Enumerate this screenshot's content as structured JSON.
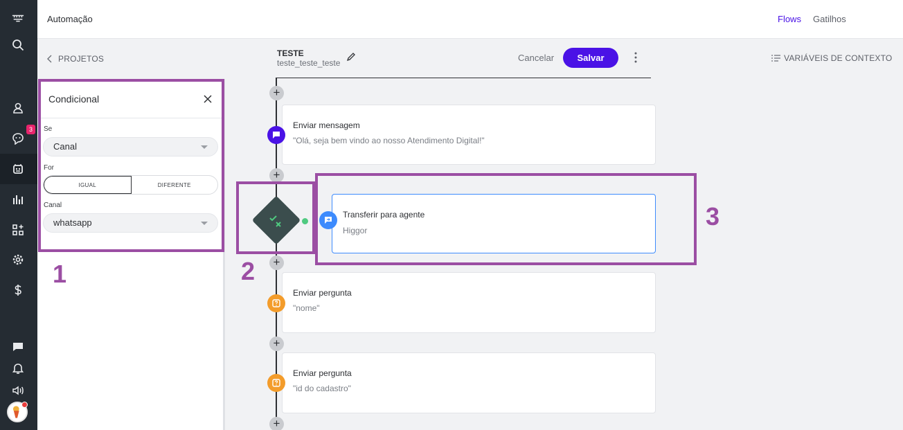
{
  "app": {
    "title": "Automação"
  },
  "nav": {
    "links": [
      "Flows",
      "Gatilhos"
    ],
    "active_color": "#4a12e6"
  },
  "rail": {
    "notification_badge": "3"
  },
  "toolbar": {
    "back_label": "PROJETOS",
    "project_name": "TESTE",
    "project_id": "teste_teste_teste",
    "cancel_label": "Cancelar",
    "save_label": "Salvar",
    "context_vars_label": "VARIÁVEIS DE CONTEXTO"
  },
  "panel": {
    "title": "Condicional",
    "if_label": "Se",
    "if_value": "Canal",
    "for_label": "For",
    "options": [
      "IGUAL",
      "DIFERENTE"
    ],
    "selected_option": "IGUAL",
    "channel_label": "Canal",
    "channel_value": "whatsapp"
  },
  "annotations": [
    "1",
    "2",
    "3"
  ],
  "flow": {
    "nodes": [
      {
        "title": "Enviar mensagem",
        "text": "\"Olá, seja bem vindo ao nosso Atendimento Digital!\"",
        "icon": "message-icon",
        "color": "#4a12e6"
      },
      {
        "title": "Transferir para agente",
        "text": "Higgor",
        "icon": "transfer-icon",
        "color": "#3d8bfd"
      },
      {
        "title": "Enviar pergunta",
        "text": "\"nome\"",
        "icon": "question-icon",
        "color": "#f39c2b"
      },
      {
        "title": "Enviar pergunta",
        "text": "\"id do cadastro\"",
        "icon": "question-icon",
        "color": "#f39c2b"
      }
    ]
  },
  "colors": {
    "annotation": "#9b4ea3",
    "rail": "#252c33",
    "primary": "#4a12e6"
  }
}
